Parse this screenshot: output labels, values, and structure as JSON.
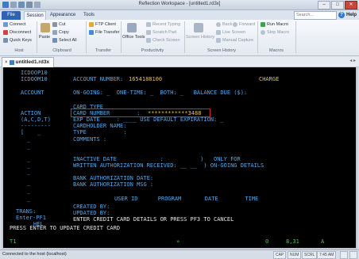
{
  "window": {
    "title": "Reflection Workspace - [untitled1.rd3x]"
  },
  "ribbon_tabs": [
    {
      "label": "File"
    },
    {
      "label": "Session"
    },
    {
      "label": "Appearance"
    },
    {
      "label": "Tools"
    }
  ],
  "search": {
    "placeholder": "Search..."
  },
  "help": {
    "label": "Help"
  },
  "ribbon": {
    "host": {
      "connect": "Connect",
      "disconnect": "Disconnect",
      "quick_keys": "Quick Keys",
      "group": "Host"
    },
    "clipboard": {
      "paste": "Paste",
      "cut": "Cut",
      "copy": "Copy",
      "select_all": "Select All",
      "group": "Clipboard"
    },
    "transfer": {
      "ftp_client": "FTP Client",
      "file_transfer": "File Transfer",
      "group": "Transfer"
    },
    "productivity": {
      "office_tools": "Office Tools",
      "recent_typing": "Recent Typing",
      "scratch_pad": "Scratch Pad",
      "spell_check": "Check Screen",
      "group": "Productivity"
    },
    "screen_history": {
      "screen_history": "Screen History",
      "back": "Back",
      "forward": "Forward",
      "live_screen": "Live Screen",
      "manual_capture": "Manual Capture",
      "group": "Screen History"
    },
    "macros": {
      "run_macro": "Run Macro",
      "stop_macro": "Stop Macro",
      "group": "Macros"
    }
  },
  "document_tab": {
    "label": "untitled1.rd3x",
    "close": "×"
  },
  "terminal": {
    "left_top1": "ICDOOP10",
    "left_top2": "ICDOOM10",
    "left_account": "ACCOUNT",
    "left_action": "ACTION",
    "left_acdt": "(A,C,D,T)",
    "left_dashes": "---------",
    "left_bracket": "[    _",
    "left_trans": "TRANS:",
    "left_enter": "Enter-PF1",
    "left_hel": "HEL",
    "account_label": "ACCOUNT NUMBER:",
    "account_number": "1654188100",
    "charge": "CHARGE",
    "ongoing_line": "ON-GOING: _  ONE-TIME: _  BOTH: _   BALANCE DUE ($):",
    "card_type_header": "CARD TYPE",
    "card_number_label": "CARD NUMBER        :",
    "card_number_value": "************3488",
    "exp_line": "EXP DATE     : ____ USE DEFAULT EXPIRATION: _",
    "cardholder_line": "CARDHOLDER NAME:",
    "type_line": "TYPE           :",
    "comments_line": "COMMENTS :",
    "inactive_line": "INACTIVE DATE             :           )   ONLY FOR",
    "written_line": "WRITTEN AUTHORIZATION RECEIVED: __ __  ) ON-GOING DETAILS",
    "bank_date_line": "BANK AUTHORIZATION DATE:",
    "bank_msg_line": "BANK AUTHORIZATION MSG :",
    "columns_line": "USER ID      PROGRAM       DATE        TIME",
    "created_line": "CREATED BY:",
    "updated_line": "UPDATED BY:",
    "instruction_line": "ENTER CREDIT CARD DETAILS OR PRESS PF3 TO CANCEL",
    "press_enter_line": "PRESS ENTER TO UPDATE CREDIT CARD",
    "status_left": "T1",
    "status_mid": "»",
    "status_num": "0",
    "status_pos": "8,31",
    "status_mode": "A"
  },
  "app_status": {
    "message": "Connected to the host (localhost)",
    "caps": "CAP",
    "num": "NUM",
    "scrl": "SCRL",
    "time": "7:45 AM"
  },
  "colors": {
    "terminal_bg": "#000000",
    "field_cyan": "#56a7e6",
    "value_yellow": "#e3c24a",
    "highlight_red": "#e02020",
    "status_green": "#4cc24c"
  }
}
